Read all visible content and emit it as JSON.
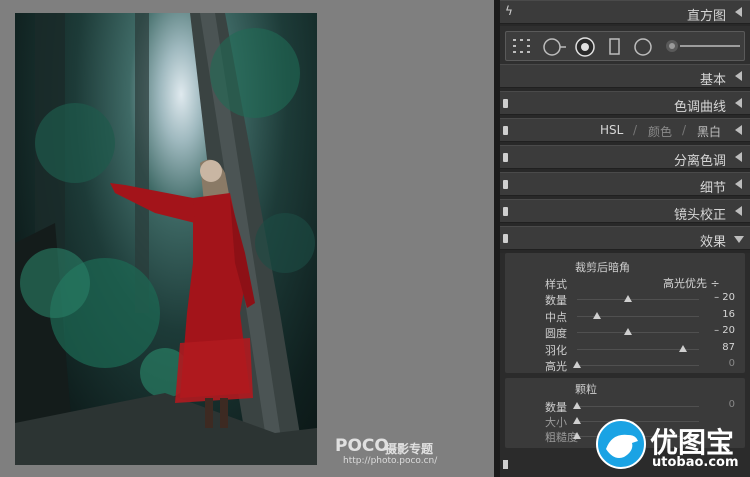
{
  "photo": {
    "watermark_brand": "POCO",
    "watermark_sub": "摄影专题",
    "watermark_url": "http://photo.poco.cn/"
  },
  "panels": {
    "histogram": "直方图",
    "basic": "基本",
    "tone_curve": "色调曲线",
    "hsl": {
      "hsl": "HSL",
      "sep": "/",
      "color": "颜色",
      "bw": "黑白"
    },
    "split_toning": "分离色调",
    "detail": "细节",
    "lens_correction": "镜头校正",
    "effects": "效果"
  },
  "effects": {
    "vignette_title": "裁剪后暗角",
    "style_label": "样式",
    "style_value": "高光优先 ÷",
    "rows": [
      {
        "label": "数量",
        "value": "– 20",
        "level": 0.42
      },
      {
        "label": "中点",
        "value": "16",
        "level": 0.16
      },
      {
        "label": "圆度",
        "value": "– 20",
        "level": 0.42
      },
      {
        "label": "羽化",
        "value": "87",
        "level": 0.87
      },
      {
        "label": "高光",
        "value": "0",
        "level": 0.0
      }
    ],
    "grain_title": "颗粒",
    "grain_rows": [
      {
        "label": "数量",
        "value": "0",
        "level": 0.0
      },
      {
        "label": "大小",
        "value": "",
        "level": 0.0
      },
      {
        "label": "粗糙度",
        "value": "",
        "level": 0.0
      }
    ]
  },
  "logo": {
    "main": "优图宝",
    "sub": "utobao.com"
  },
  "colors": {
    "panel_bg": "#282828",
    "header_bg": "#3b3b3b",
    "logo_blue": "#1aa3e4",
    "dress_red": "#a3141a"
  },
  "icons": [
    "lightning-icon",
    "grid-tool-icon",
    "crop-circle-icon",
    "spot-removal-icon",
    "red-eye-icon",
    "graduated-filter-icon",
    "radial-filter-icon",
    "brush-slider-icon"
  ]
}
